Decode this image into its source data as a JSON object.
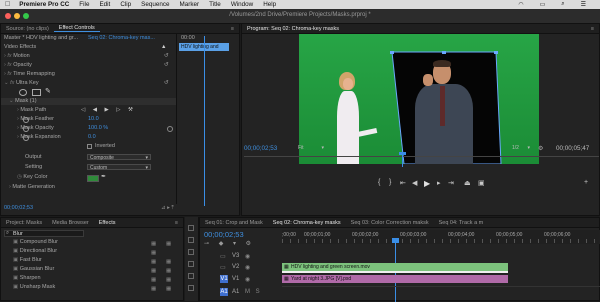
{
  "menubar": {
    "app_name": "Premiere Pro CC",
    "items": [
      "File",
      "Edit",
      "Clip",
      "Sequence",
      "Marker",
      "Title",
      "Window",
      "Help"
    ]
  },
  "window": {
    "title": "/Volumes/2nd Drive/Premiere Projects/Masks.prproj *"
  },
  "effect_controls": {
    "tabs": [
      "Source: (no clips)",
      "Effect Controls"
    ],
    "master_label": "Master * HDV lighting and gr...",
    "sequence_label": "Seq 02: Chroma-key mas...",
    "mini_time": "00:00",
    "clip_name": "HDV lighting and",
    "section_video_effects": "Video Effects",
    "rows": [
      "Motion",
      "Opacity",
      "Time Remapping",
      "Ultra Key"
    ],
    "mask_title": "Mask (1)",
    "mask_path": "Mask Path",
    "mask_feather": "Mask Feather",
    "mask_feather_value": "10.0",
    "mask_opacity": "Mask Opacity",
    "mask_opacity_value": "100.0 %",
    "mask_expansion": "Mask Expansion",
    "mask_expansion_value": "0.0",
    "inverted": "Inverted",
    "output_label": "Output",
    "output_value": "Composite",
    "setting_label": "Setting",
    "setting_value": "Custom",
    "key_color": "Key Color",
    "matte_generation": "Matte Generation",
    "timecode": "00;00;02;53"
  },
  "program_monitor": {
    "title": "Program: Seq 02: Chroma-key masks",
    "timecode": "00;00;02;53",
    "fit": "Fit",
    "resolution": "1/2",
    "duration": "00;00;05;47"
  },
  "project_panel": {
    "tabs": [
      "Project: Masks",
      "Media Browser",
      "Effects"
    ],
    "search_value": "Blur",
    "items": [
      "Compound Blur",
      "Directional Blur",
      "Fast Blur",
      "Gaussian Blur",
      "Sharpen",
      "Unsharp Mask"
    ]
  },
  "timeline": {
    "tabs": [
      "Seq 01: Crop and Mask",
      "Seq 02: Chroma-key masks",
      "Seq 03: Color Correction maksk",
      "Seq 04: Track a m"
    ],
    "timecode": "00;00;02;53",
    "ruler_labels": [
      ";00;00",
      "00;00;01;00",
      "00;00;02;00",
      "00;00;03;00",
      "00;00;04;00",
      "00;00;05;00",
      "00;00;06;00"
    ],
    "tracks": [
      "V3",
      "V2",
      "V1",
      "A1"
    ],
    "clip_v2": "HDV lighting and green screen.mov",
    "clip_v1": "Yard at night 3.JPG [V].psd"
  },
  "colors": {
    "accent_blue": "#3f8fdf",
    "green_screen": "#1d9a3a",
    "clip_green": "#7cc27c",
    "clip_magenta": "#b06aa8",
    "playhead": "#3a8ee6"
  }
}
